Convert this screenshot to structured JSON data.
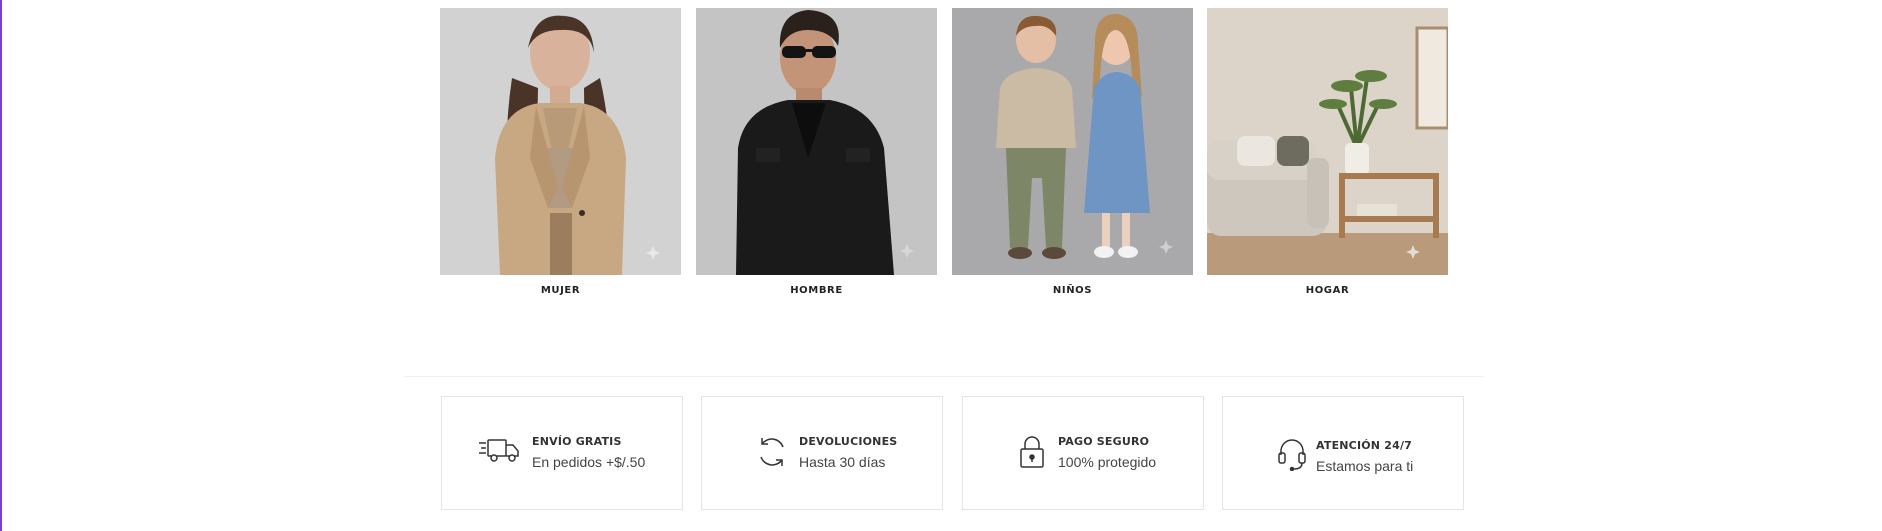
{
  "categories": [
    {
      "label": "MUJER",
      "image": "woman in beige blazer"
    },
    {
      "label": "HOMBRE",
      "image": "man in black jacket with sunglasses"
    },
    {
      "label": "NIÑOS",
      "image": "two children standing"
    },
    {
      "label": "HOGAR",
      "image": "living room with sofa and plants"
    }
  ],
  "features": [
    {
      "icon": "truck-icon",
      "title": "ENVÍO GRATIS",
      "subtitle": "En pedidos +$/.50"
    },
    {
      "icon": "refresh-icon",
      "title": "DEVOLUCIONES",
      "subtitle": "Hasta 30 días"
    },
    {
      "icon": "lock-icon",
      "title": "PAGO SEGURO",
      "subtitle": "100% protegido"
    },
    {
      "icon": "headset-icon",
      "title": "ATENCIÓN 24/7",
      "subtitle": "Estamos para ti"
    }
  ],
  "colors": {
    "accent_edge": "#7b3fd6",
    "card_border": "#e4e4e4"
  }
}
